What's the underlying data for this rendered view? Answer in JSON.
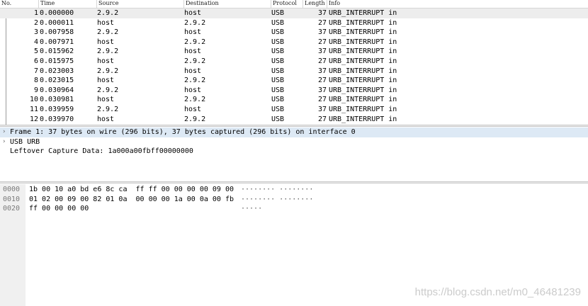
{
  "packet_list": {
    "columns": [
      "No.",
      "Time",
      "Source",
      "Destination",
      "Protocol",
      "Length",
      "Info"
    ],
    "rows": [
      {
        "no": "1",
        "time": "0.000000",
        "source": "2.9.2",
        "destination": "host",
        "protocol": "USB",
        "length": "37",
        "info": "URB_INTERRUPT in"
      },
      {
        "no": "2",
        "time": "0.000011",
        "source": "host",
        "destination": "2.9.2",
        "protocol": "USB",
        "length": "27",
        "info": "URB_INTERRUPT in"
      },
      {
        "no": "3",
        "time": "0.007958",
        "source": "2.9.2",
        "destination": "host",
        "protocol": "USB",
        "length": "37",
        "info": "URB_INTERRUPT in"
      },
      {
        "no": "4",
        "time": "0.007971",
        "source": "host",
        "destination": "2.9.2",
        "protocol": "USB",
        "length": "27",
        "info": "URB_INTERRUPT in"
      },
      {
        "no": "5",
        "time": "0.015962",
        "source": "2.9.2",
        "destination": "host",
        "protocol": "USB",
        "length": "37",
        "info": "URB_INTERRUPT in"
      },
      {
        "no": "6",
        "time": "0.015975",
        "source": "host",
        "destination": "2.9.2",
        "protocol": "USB",
        "length": "27",
        "info": "URB_INTERRUPT in"
      },
      {
        "no": "7",
        "time": "0.023003",
        "source": "2.9.2",
        "destination": "host",
        "protocol": "USB",
        "length": "37",
        "info": "URB_INTERRUPT in"
      },
      {
        "no": "8",
        "time": "0.023015",
        "source": "host",
        "destination": "2.9.2",
        "protocol": "USB",
        "length": "27",
        "info": "URB_INTERRUPT in"
      },
      {
        "no": "9",
        "time": "0.030964",
        "source": "2.9.2",
        "destination": "host",
        "protocol": "USB",
        "length": "37",
        "info": "URB_INTERRUPT in"
      },
      {
        "no": "10",
        "time": "0.030981",
        "source": "host",
        "destination": "2.9.2",
        "protocol": "USB",
        "length": "27",
        "info": "URB_INTERRUPT in"
      },
      {
        "no": "11",
        "time": "0.039959",
        "source": "2.9.2",
        "destination": "host",
        "protocol": "USB",
        "length": "37",
        "info": "URB_INTERRUPT in"
      },
      {
        "no": "12",
        "time": "0.039970",
        "source": "host",
        "destination": "2.9.2",
        "protocol": "USB",
        "length": "27",
        "info": "URB_INTERRUPT in"
      }
    ],
    "selected_index": 0
  },
  "details": {
    "rows": [
      {
        "text": "Frame 1: 37 bytes on wire (296 bits), 37 bytes captured (296 bits) on interface 0",
        "expandable": true,
        "selected": true
      },
      {
        "text": "USB URB",
        "expandable": true,
        "selected": false
      },
      {
        "text": "Leftover Capture Data: 1a000a00fbff00000000",
        "expandable": false,
        "selected": false
      }
    ]
  },
  "bytes": {
    "rows": [
      {
        "offset": "0000",
        "hex": "1b 00 10 a0 bd e6 8c ca  ff ff 00 00 00 00 09 00",
        "ascii": "········ ········"
      },
      {
        "offset": "0010",
        "hex": "01 02 00 09 00 82 01 0a  00 00 00 1a 00 0a 00 fb",
        "ascii": "········ ········"
      },
      {
        "offset": "0020",
        "hex": "ff 00 00 00 00",
        "ascii": "·····"
      }
    ]
  },
  "watermark": "https://blog.csdn.net/m0_46481239",
  "colors": {
    "selected_packet_row": "#ededed",
    "selected_detail_row": "#dde9f5",
    "bytes_gutter": "#f0f0f0"
  }
}
